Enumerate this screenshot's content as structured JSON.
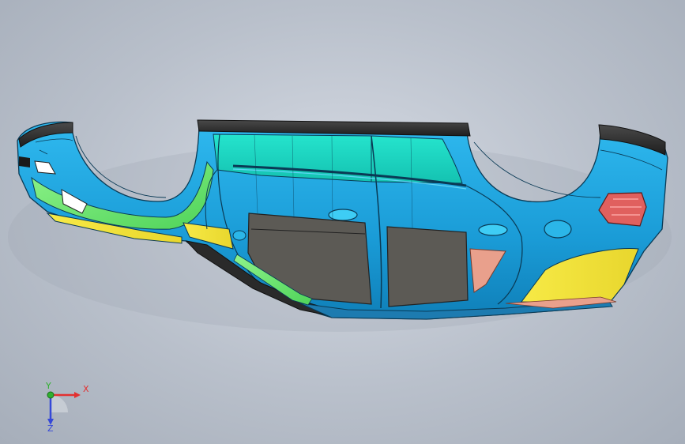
{
  "viewport": {
    "background": "#b9c0cb",
    "model": {
      "icon": "car-body-cad-model-icon",
      "colors": {
        "body": "#1aa6e0",
        "cyan_panel": "#19d6c2",
        "green_panel": "#6ee36e",
        "yellow_panel": "#f2e23a",
        "dark_panel": "#5c5a55",
        "salmon_panel": "#e9a08c",
        "red_lamp": "#e0605e",
        "black_trim": "#2a2a2a"
      }
    },
    "triad": {
      "icon": "axis-triad-icon",
      "x_label": "X",
      "y_label": "Y",
      "z_label": "Z",
      "x_color": "#e23030",
      "y_color": "#2fb02f",
      "z_color": "#3548d8"
    }
  }
}
